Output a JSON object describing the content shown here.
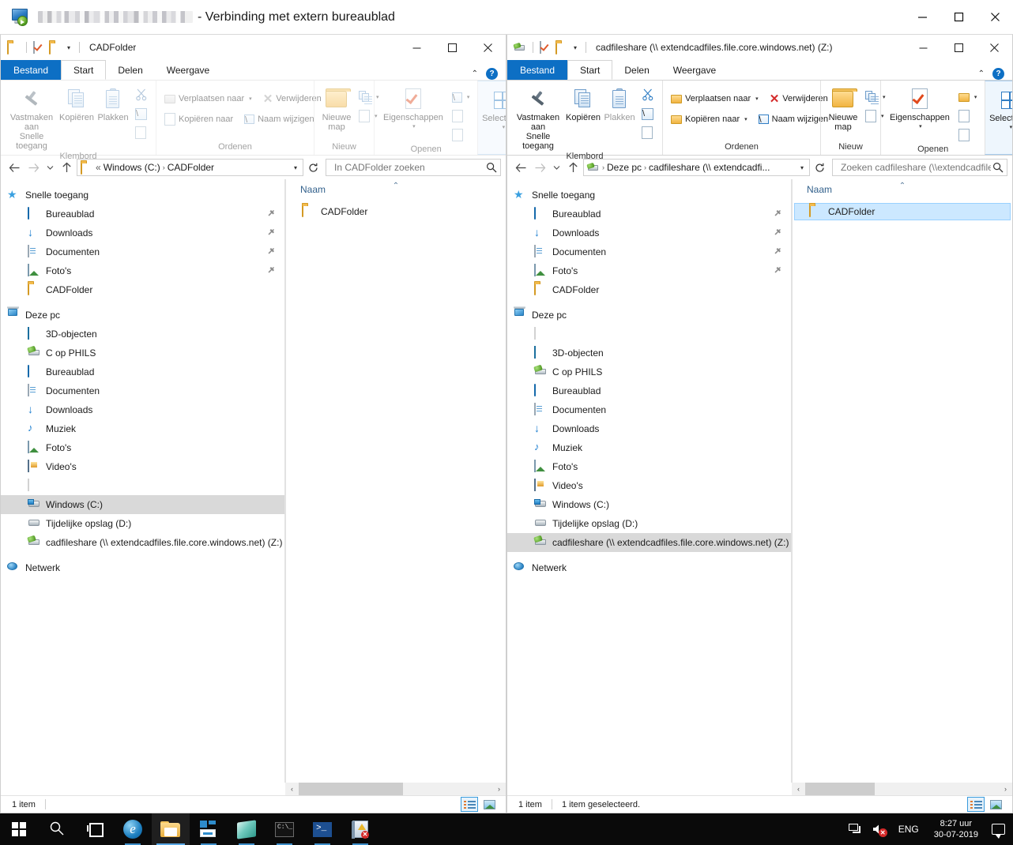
{
  "rdp": {
    "title_suffix": "- Verbinding met extern bureaublad",
    "computer_name_redacted": "",
    "icon": "remote-desktop-icon",
    "minimize": "–",
    "restore": "❐",
    "close": "✕"
  },
  "ribbon_common": {
    "tabs": {
      "file": "Bestand",
      "home": "Start",
      "share": "Delen",
      "view": "Weergave"
    },
    "collapse_caret": "⌃",
    "help": "?",
    "groups": {
      "clipboard": {
        "label": "Klembord",
        "pin": "Vastmaken aan\nSnelle toegang",
        "pin_line1": "Vastmaken aan",
        "pin_line2": "Snelle toegang",
        "copy": "Kopiëren",
        "paste": "Plakken",
        "cut_icon": "scissors-icon",
        "copy_path_icon": "copy-path-icon",
        "paste_shortcut_icon": "paste-shortcut-icon"
      },
      "organize": {
        "label": "Ordenen",
        "move_to": "Verplaatsen naar",
        "copy_to": "Kopiëren naar",
        "delete": "Verwijderen",
        "rename": "Naam wijzigen"
      },
      "new": {
        "label": "Nieuw",
        "new_folder_line1": "Nieuwe",
        "new_folder_line2": "map",
        "new_item_icon": "new-item-icon",
        "easy_access_icon": "easy-access-icon"
      },
      "open": {
        "label": "Openen",
        "properties": "Eigenschappen",
        "open_icon": "open-icon",
        "edit_icon": "edit-icon",
        "history_icon": "history-icon"
      },
      "select": {
        "label": "",
        "select": "Selecteren"
      }
    }
  },
  "left_window": {
    "title": "CADFolder",
    "qat": {
      "folder_icon": "folder-icon",
      "properties_icon": "properties-checkmark-icon",
      "new_folder_icon": "new-folder-icon",
      "customize_caret": "▾"
    },
    "controls": {
      "minimize": "–",
      "maximize": "❐",
      "close": "✕"
    },
    "address": {
      "back": "←",
      "forward": "→",
      "recent": "▾",
      "up": "↑",
      "icon": "folder-icon",
      "crumb_prefix": "«",
      "crumbs": [
        "Windows (C:)",
        "CADFolder"
      ],
      "dropdown_caret": "▾",
      "refresh": "↻"
    },
    "search": {
      "placeholder": "In CADFolder zoeken",
      "value": "",
      "icon": "search-icon"
    },
    "nav_tree": [
      {
        "label": "Snelle toegang",
        "icon": "star-icon",
        "level": "root",
        "pinned": false,
        "selected": false
      },
      {
        "label": "Bureaublad",
        "icon": "desktop-icon",
        "level": "child",
        "pinned": true,
        "selected": false
      },
      {
        "label": "Downloads",
        "icon": "download-icon",
        "level": "child",
        "pinned": true,
        "selected": false
      },
      {
        "label": "Documenten",
        "icon": "documents-icon",
        "level": "child",
        "pinned": true,
        "selected": false
      },
      {
        "label": "Foto's",
        "icon": "pictures-icon",
        "level": "child",
        "pinned": true,
        "selected": false
      },
      {
        "label": "CADFolder",
        "icon": "folder-icon",
        "level": "child",
        "pinned": false,
        "selected": false
      },
      {
        "label": "",
        "icon": "spacer",
        "level": "spacer",
        "pinned": false,
        "selected": false
      },
      {
        "label": "Deze pc",
        "icon": "this-pc-icon",
        "level": "root",
        "pinned": false,
        "selected": false
      },
      {
        "label": "3D-objecten",
        "icon": "3d-objects-icon",
        "level": "child",
        "pinned": false,
        "selected": false
      },
      {
        "label": "C op PHILS",
        "icon": "network-drive-icon",
        "level": "child",
        "pinned": false,
        "selected": false
      },
      {
        "label": "Bureaublad",
        "icon": "desktop-icon",
        "level": "child",
        "pinned": false,
        "selected": false
      },
      {
        "label": "Documenten",
        "icon": "documents-icon",
        "level": "child",
        "pinned": false,
        "selected": false
      },
      {
        "label": "Downloads",
        "icon": "download-icon",
        "level": "child",
        "pinned": false,
        "selected": false
      },
      {
        "label": "Muziek",
        "icon": "music-icon",
        "level": "child",
        "pinned": false,
        "selected": false
      },
      {
        "label": "Foto's",
        "icon": "pictures-icon",
        "level": "child",
        "pinned": false,
        "selected": false
      },
      {
        "label": "Video's",
        "icon": "videos-icon",
        "level": "child",
        "pinned": false,
        "selected": false
      },
      {
        "label": "",
        "icon": "blank-icon",
        "level": "child",
        "pinned": false,
        "selected": false
      },
      {
        "label": "Windows (C:)",
        "icon": "windows-drive-icon",
        "level": "child",
        "pinned": false,
        "selected": true
      },
      {
        "label": "Tijdelijke opslag (D:)",
        "icon": "hdd-icon",
        "level": "child",
        "pinned": false,
        "selected": false
      },
      {
        "label": "cadfileshare (\\\\ extendcadfiles.file.core.windows.net) (Z:)",
        "icon": "network-drive-icon",
        "level": "child",
        "pinned": false,
        "selected": false
      },
      {
        "label": "",
        "icon": "spacer",
        "level": "spacer",
        "pinned": false,
        "selected": false
      },
      {
        "label": "Netwerk",
        "icon": "network-icon",
        "level": "root",
        "pinned": false,
        "selected": false
      }
    ],
    "column_header": "Naam",
    "sort_indicator": "⌃",
    "files": [
      {
        "name": "CADFolder",
        "icon": "folder-icon",
        "selected": false
      }
    ],
    "status": {
      "count": "1 item",
      "selection": ""
    },
    "view_buttons": {
      "details": "details-view-button",
      "tiles": "large-icons-view-button",
      "active": "details"
    },
    "hscroll": {
      "left_arrow": "‹",
      "right_arrow": "›"
    }
  },
  "right_window": {
    "title": "cadfileshare (\\\\ extendcadfiles.file.core.windows.net) (Z:)",
    "qat": {
      "drive_icon": "network-drive-icon",
      "properties_icon": "properties-checkmark-icon",
      "new_folder_icon": "new-folder-icon",
      "customize_caret": "▾"
    },
    "controls": {
      "minimize": "–",
      "maximize": "❐",
      "close": "✕"
    },
    "address": {
      "back": "←",
      "forward": "→",
      "recent": "▾",
      "up": "↑",
      "icon": "network-drive-icon",
      "crumbs": [
        "Deze pc",
        "cadfileshare (\\\\ extendcadfi..."
      ],
      "dropdown_caret": "▾",
      "refresh": "↻"
    },
    "search": {
      "placeholder": "Zoeken cadfileshare (\\\\extendcadfiles.fil ...",
      "value": "",
      "icon": "search-icon"
    },
    "nav_tree": [
      {
        "label": "Snelle toegang",
        "icon": "star-icon",
        "level": "root",
        "pinned": false,
        "selected": false
      },
      {
        "label": "Bureaublad",
        "icon": "desktop-icon",
        "level": "child",
        "pinned": true,
        "selected": false
      },
      {
        "label": "Downloads",
        "icon": "download-icon",
        "level": "child",
        "pinned": true,
        "selected": false
      },
      {
        "label": "Documenten",
        "icon": "documents-icon",
        "level": "child",
        "pinned": true,
        "selected": false
      },
      {
        "label": "Foto's",
        "icon": "pictures-icon",
        "level": "child",
        "pinned": true,
        "selected": false
      },
      {
        "label": "CADFolder",
        "icon": "folder-icon",
        "level": "child",
        "pinned": false,
        "selected": false
      },
      {
        "label": "",
        "icon": "spacer",
        "level": "spacer",
        "pinned": false,
        "selected": false
      },
      {
        "label": "Deze pc",
        "icon": "this-pc-icon",
        "level": "root",
        "pinned": false,
        "selected": false
      },
      {
        "label": "",
        "icon": "blank-icon",
        "level": "child",
        "pinned": false,
        "selected": false
      },
      {
        "label": "3D-objecten",
        "icon": "3d-objects-icon",
        "level": "child",
        "pinned": false,
        "selected": false
      },
      {
        "label": "C op PHILS",
        "icon": "network-drive-icon",
        "level": "child",
        "pinned": false,
        "selected": false
      },
      {
        "label": "Bureaublad",
        "icon": "desktop-icon",
        "level": "child",
        "pinned": false,
        "selected": false
      },
      {
        "label": "Documenten",
        "icon": "documents-icon",
        "level": "child",
        "pinned": false,
        "selected": false
      },
      {
        "label": "Downloads",
        "icon": "download-icon",
        "level": "child",
        "pinned": false,
        "selected": false
      },
      {
        "label": "Muziek",
        "icon": "music-icon",
        "level": "child",
        "pinned": false,
        "selected": false
      },
      {
        "label": "Foto's",
        "icon": "pictures-icon",
        "level": "child",
        "pinned": false,
        "selected": false
      },
      {
        "label": "Video's",
        "icon": "videos-icon",
        "level": "child",
        "pinned": false,
        "selected": false
      },
      {
        "label": "Windows (C:)",
        "icon": "windows-drive-icon",
        "level": "child",
        "pinned": false,
        "selected": false
      },
      {
        "label": "Tijdelijke opslag (D:)",
        "icon": "hdd-icon",
        "level": "child",
        "pinned": false,
        "selected": false
      },
      {
        "label": "cadfileshare (\\\\ extendcadfiles.file.core.windows.net) (Z:)",
        "icon": "network-drive-icon",
        "level": "child",
        "pinned": false,
        "selected": true
      },
      {
        "label": "",
        "icon": "spacer",
        "level": "spacer",
        "pinned": false,
        "selected": false
      },
      {
        "label": "Netwerk",
        "icon": "network-icon",
        "level": "root",
        "pinned": false,
        "selected": false
      }
    ],
    "column_header": "Naam",
    "sort_indicator": "⌃",
    "files": [
      {
        "name": "CADFolder",
        "icon": "folder-icon",
        "selected": true
      }
    ],
    "status": {
      "count": "1 item",
      "selection": "1 item geselecteerd."
    },
    "view_buttons": {
      "details": "details-view-button",
      "tiles": "large-icons-view-button",
      "active": "details"
    },
    "hscroll": {
      "left_arrow": "‹",
      "right_arrow": "›"
    }
  },
  "taskbar": {
    "items": [
      {
        "name": "start-button",
        "icon": "windows-logo-icon",
        "state": "idle"
      },
      {
        "name": "search-button",
        "icon": "search-icon",
        "state": "idle"
      },
      {
        "name": "task-view-button",
        "icon": "task-view-icon",
        "state": "idle"
      },
      {
        "name": "internet-explorer-button",
        "icon": "internet-explorer-icon",
        "state": "running"
      },
      {
        "name": "file-explorer-button",
        "icon": "file-explorer-icon",
        "state": "active"
      },
      {
        "name": "server-manager-button",
        "icon": "server-manager-icon",
        "state": "running"
      },
      {
        "name": "app-teal-button",
        "icon": "teal-app-icon",
        "state": "running"
      },
      {
        "name": "command-prompt-button",
        "icon": "command-prompt-icon",
        "state": "running"
      },
      {
        "name": "powershell-button",
        "icon": "powershell-icon",
        "state": "running"
      },
      {
        "name": "event-viewer-button",
        "icon": "event-viewer-icon",
        "state": "running"
      }
    ],
    "tray": {
      "network_icon": "network-icon",
      "volume_icon": "volume-muted-icon",
      "language": "ENG",
      "time": "8:27 uur",
      "date": "30-07-2019",
      "notifications_icon": "action-center-icon"
    }
  },
  "colors": {
    "accent_blue": "#0d6fc4",
    "selection_blue": "#cce8ff",
    "tree_selection_grey": "#d9d9d9",
    "taskbar_black": "#0a0a0a",
    "folder_gold": "#f0b33d",
    "delete_red": "#d42a2a"
  }
}
